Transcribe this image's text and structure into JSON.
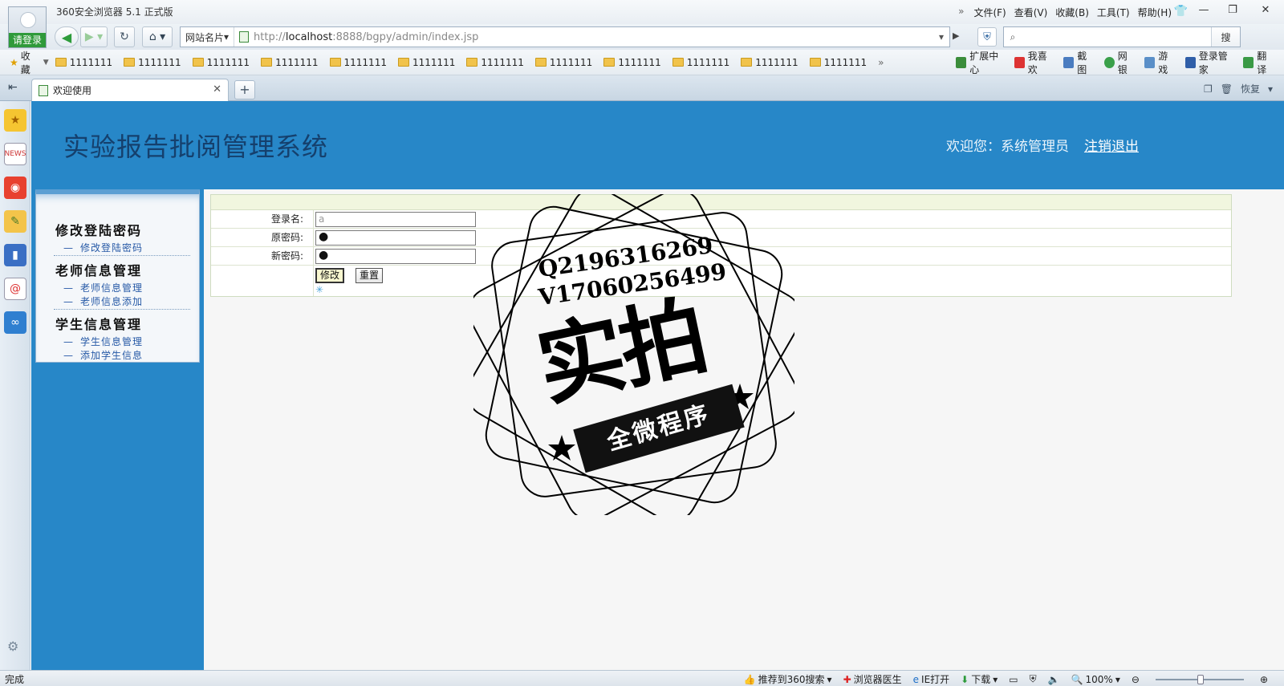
{
  "titlebar": {
    "login_label": "请登录",
    "title": "360安全浏览器 5.1 正式版",
    "menu": [
      "文件(F)",
      "查看(V)",
      "收藏(B)",
      "工具(T)",
      "帮助(H)"
    ]
  },
  "navbar": {
    "site_dropdown": "网站名片",
    "url_prefix": "http://",
    "url_host": "localhost",
    "url_rest": ":8888/bgpy/admin/index.jsp",
    "search_button": "搜"
  },
  "favbar": {
    "favorites_label": "收藏",
    "folders": [
      "1111111",
      "1111111",
      "1111111",
      "1111111",
      "1111111",
      "1111111",
      "1111111",
      "1111111",
      "1111111",
      "1111111",
      "1111111",
      "1111111"
    ],
    "extensions": [
      "扩展中心",
      "我喜欢",
      "截图",
      "网银",
      "游戏",
      "登录管家",
      "翻译"
    ]
  },
  "tabs": {
    "active_tab": "欢迎使用",
    "restore_label": "恢复"
  },
  "header": {
    "system_title": "实验报告批阅管理系统",
    "welcome": "欢迎您：系统管理员",
    "logout": "注销退出"
  },
  "sidebar": {
    "groups": [
      {
        "title": "修改登陆密码",
        "items": [
          "修改登陆密码"
        ]
      },
      {
        "title": "老师信息管理",
        "items": [
          "老师信息管理",
          "老师信息添加"
        ]
      },
      {
        "title": "学生信息管理",
        "items": [
          "学生信息管理",
          "添加学生信息"
        ]
      }
    ]
  },
  "form": {
    "login_name_label": "登录名:",
    "login_name_value": "a",
    "old_password_label": "原密码:",
    "old_password_value": "●",
    "new_password_label": "新密码:",
    "new_password_value": "●",
    "submit_label": "修改",
    "reset_label": "重置"
  },
  "watermark": {
    "line1": "Q2196316269",
    "line2": "V17060256499",
    "big": "实拍",
    "ribbon": "全微程序"
  },
  "statusbar": {
    "status": "完成",
    "items": [
      "推荐到360搜索",
      "浏览器医生",
      "IE打开",
      "下载"
    ],
    "zoom": "100%"
  },
  "colors": {
    "page_blue": "#2787c8",
    "title_navy": "#15406d",
    "menu_link": "#2659a6"
  }
}
